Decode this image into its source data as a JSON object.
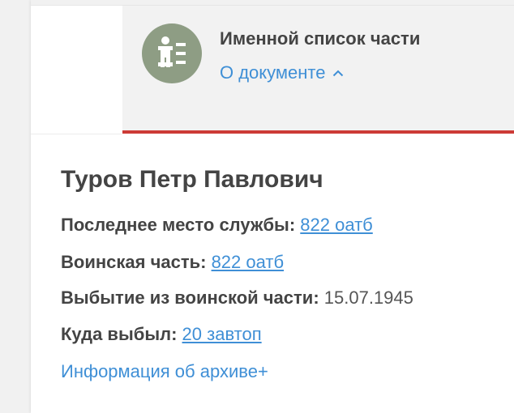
{
  "header": {
    "icon": "person-list-icon",
    "title": "Именной список части",
    "about_label": "О документе",
    "about_chevron": "chevron-up-icon",
    "accent_color": "#cc3b36",
    "icon_bg_color": "#8e9d84",
    "link_color": "#3f8fd6"
  },
  "person": {
    "name": "Туров Петр Павлович",
    "fields": [
      {
        "label": "Последнее место службы:",
        "value": "822 оатб"
      },
      {
        "label": "Воинская часть:",
        "value": "822 оатб"
      },
      {
        "label": "Выбытие из воинской части:",
        "value": "15.07.1945"
      },
      {
        "label": "Куда выбыл:",
        "value": "20 завтоп"
      }
    ],
    "archive_link": "Информация об архиве+"
  }
}
